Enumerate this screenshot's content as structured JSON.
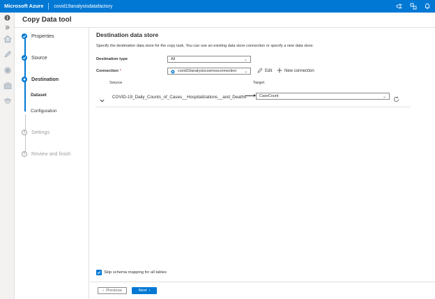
{
  "topbar": {
    "brand": "Microsoft Azure",
    "factory_name": "covid19analysisdatafactory",
    "icons": [
      "feedback-icon",
      "directory-switch-icon",
      "notifications-icon"
    ]
  },
  "rail": {
    "icons": [
      "info-icon",
      "expand-icon",
      "home-icon",
      "author-pencil-icon",
      "monitor-icon",
      "manage-toolbox-icon",
      "learning-icon"
    ]
  },
  "tool_title": "Copy Data tool",
  "steps": {
    "properties": "Properties",
    "source": "Source",
    "destination": "Destination",
    "dataset": "Dataset",
    "configuration": "Configuration",
    "settings": "Settings",
    "settings_num": "4",
    "review": "Review and finish",
    "review_num": "5"
  },
  "main": {
    "title": "Destination data store",
    "description": "Specify the destination data store for the copy task. You can use an existing data store connection or specify a new data store.",
    "destination_type_label": "Destination type",
    "destination_type_value": "All",
    "connection_label": "Connection",
    "connection_required": "*",
    "connection_value": "covid19analysiscosmosconnection",
    "edit_label": "Edit",
    "new_connection_label": "New connection",
    "source_header": "Source",
    "target_header": "Target",
    "mapping_source": "COVID-19_Daily_Counts_of_Cases__Hospitalizations__and_Deaths",
    "mapping_target": "CaseCount",
    "skip_schema_label": "Skip schema mapping for all tables",
    "skip_schema_checked": true,
    "previous_label": "Previous",
    "next_label": "Next"
  },
  "colors": {
    "accent": "#0078d4",
    "topbar": "#0078d4",
    "pending": "#a19f9d"
  }
}
